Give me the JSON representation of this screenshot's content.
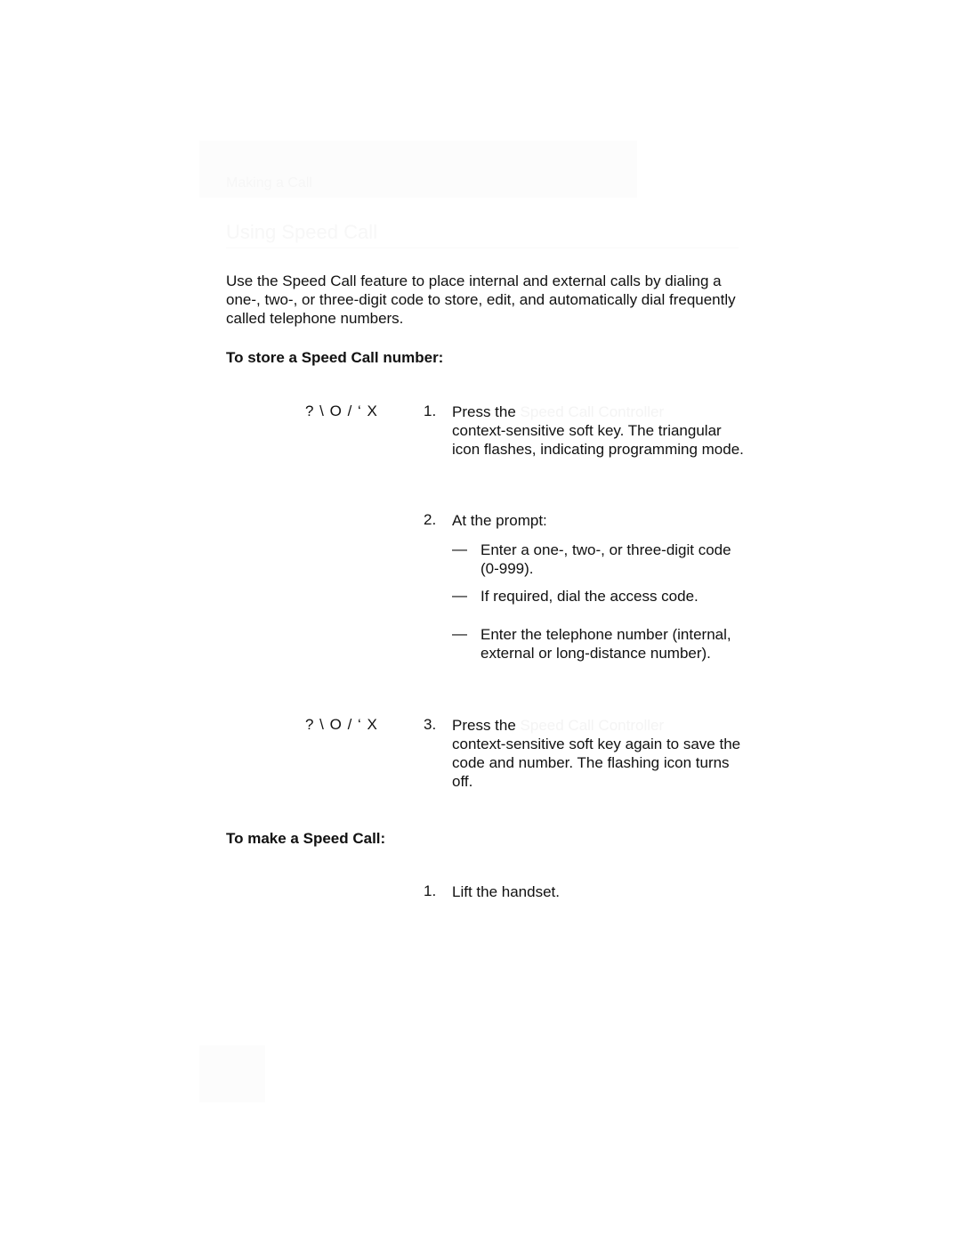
{
  "header": {
    "section_label": "Making a Call"
  },
  "title": "Using Speed Call",
  "intro": "Use the Speed Call feature to place internal and external calls by dialing a one-, two-, or three-digit code to store, edit, and automatically dial frequently called telephone numbers.",
  "store_section": {
    "heading": "To store a Speed Call number:",
    "key_label": "? \\ O / ‘ X",
    "steps": [
      {
        "number": "1.",
        "lead": "Press the ",
        "faint": "Speed Call Controller",
        "rest": "context-sensitive soft key. The triangular icon flashes, indicating programming mode."
      },
      {
        "number": "2.",
        "text": "At the prompt:",
        "substeps": [
          "Enter a one-, two-, or three-digit code (0-999).",
          "If required, dial the access code.",
          "Enter the telephone number (internal, external or long-distance number)."
        ]
      },
      {
        "number": "3.",
        "lead": "Press the ",
        "faint": "Speed Call Controller",
        "rest": "context-sensitive soft key again to save the code and number. The flashing icon turns off."
      }
    ]
  },
  "make_section": {
    "heading": "To make a Speed Call:",
    "steps": [
      {
        "number": "1.",
        "text": "Lift the handset."
      }
    ]
  },
  "dash_glyph": "—"
}
